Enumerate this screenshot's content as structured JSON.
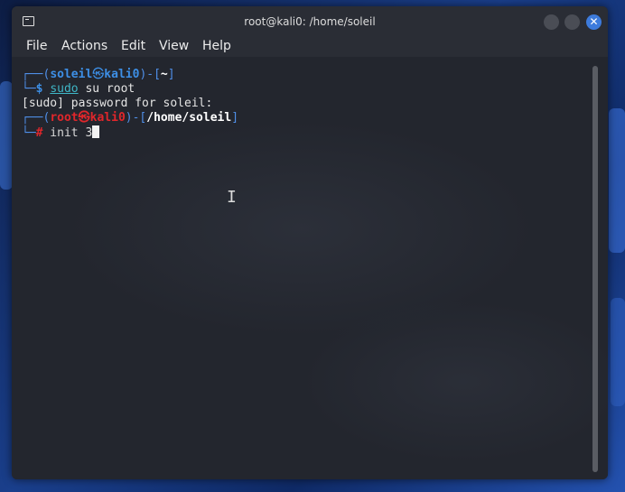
{
  "window": {
    "title": "root@kali0: /home/soleil",
    "close_glyph": "✕"
  },
  "menu": {
    "items": [
      "File",
      "Actions",
      "Edit",
      "View",
      "Help"
    ]
  },
  "terminal": {
    "line1": {
      "frame_open": "┌──(",
      "user": "soleil",
      "at": "㉿",
      "host": "kali0",
      "frame_mid": ")-[",
      "path": "~",
      "frame_close": "]"
    },
    "line2": {
      "frame": "└─",
      "prompt": "$",
      "cmd": "sudo",
      "args": " su root"
    },
    "line3": "[sudo] password for soleil:",
    "line4": {
      "frame_open": "┌──(",
      "user": "root",
      "at": "㉿",
      "host": "kali0",
      "frame_mid": ")-[",
      "path": "/home/soleil",
      "frame_close": "]"
    },
    "line5": {
      "frame": "└─",
      "prompt": "#",
      "cmd": " init 3"
    }
  },
  "colors": {
    "user_blue": "#3d8fe6",
    "root_red": "#e0262b",
    "sudo_cyan": "#3fb7c7",
    "close_button": "#3d7bdc"
  },
  "icons": [
    "terminal-icon",
    "minimize-icon",
    "maximize-icon",
    "close-icon",
    "text-cursor-icon"
  ]
}
